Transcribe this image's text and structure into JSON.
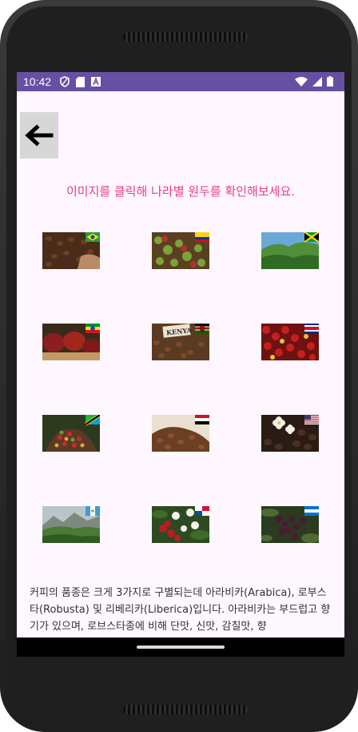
{
  "status_bar": {
    "time": "10:42"
  },
  "toolbar": {
    "back_icon": "arrow-left-icon"
  },
  "instruction": "이미지를 클릭해 나라별 원두를 확인해보세요.",
  "coffee_grid": [
    {
      "name": "brazil"
    },
    {
      "name": "colombia"
    },
    {
      "name": "jamaica"
    },
    {
      "name": "ethiopia"
    },
    {
      "name": "kenya",
      "sack_label": "KENYA"
    },
    {
      "name": "costa-rica"
    },
    {
      "name": "tanzania"
    },
    {
      "name": "yemen"
    },
    {
      "name": "usa"
    },
    {
      "name": "guatemala"
    },
    {
      "name": "panama"
    },
    {
      "name": "honduras"
    }
  ],
  "description": "커피의 품종은 크게 3가지로 구별되는데 아라비카(Arabica), 로부스타(Robusta) 및 리베리카(Liberica)입니다. 아라비카는 부드럽고 향기가 있으며, 로브스타종에 비해 단맛, 신맛, 감칠맛, 향",
  "colors": {
    "status_bar": "#6750a4",
    "accent_text": "#e83e8c",
    "screen_bg": "#fef7ff"
  }
}
